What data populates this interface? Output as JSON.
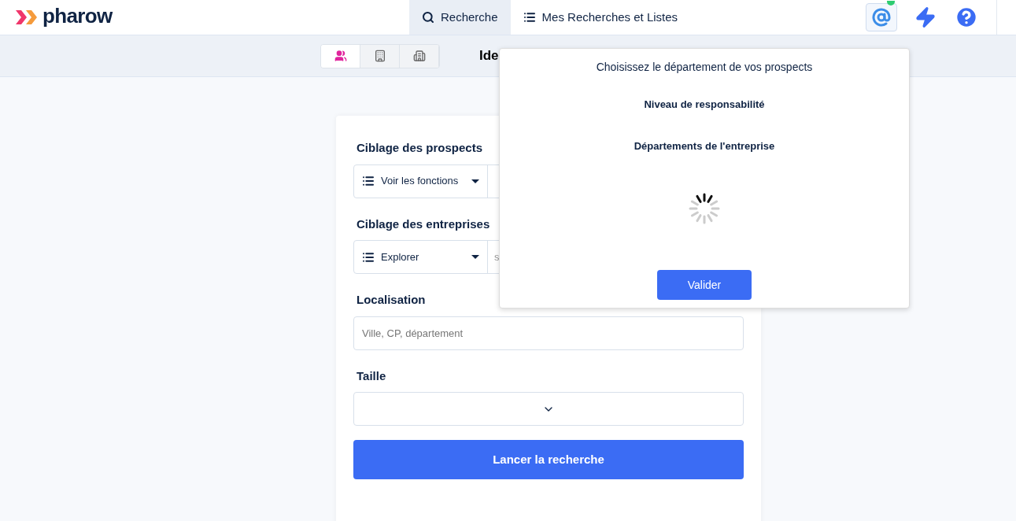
{
  "header": {
    "logo": "pharow",
    "nav_tabs": [
      {
        "label": "Recherche",
        "kind": "search",
        "selected": true
      },
      {
        "label": "Mes Recherches et Listes",
        "kind": "list",
        "selected": false
      }
    ]
  },
  "view_toggle": [
    {
      "kind": "people",
      "selected": true
    },
    {
      "kind": "building",
      "selected": false
    },
    {
      "kind": "buildings",
      "selected": false
    }
  ],
  "page_title": "Ide",
  "form": {
    "sections": [
      {
        "kind": "split",
        "heading": "Ciblage des prospects",
        "select": "Voir les fonctions"
      },
      {
        "kind": "split",
        "heading": "Ciblage des entreprises",
        "select": "Explorer",
        "placeholder": "s"
      },
      {
        "kind": "text",
        "heading": "Localisation",
        "placeholder": "Ville, CP, département"
      },
      {
        "kind": "dropdown",
        "heading": "Taille"
      }
    ],
    "submit": "Lancer la recherche"
  },
  "popover": {
    "title": "Choisissez le département de vos prospects",
    "headings": [
      "Niveau de responsabilité",
      "Départements de l'entreprise"
    ],
    "button": "Valider"
  }
}
